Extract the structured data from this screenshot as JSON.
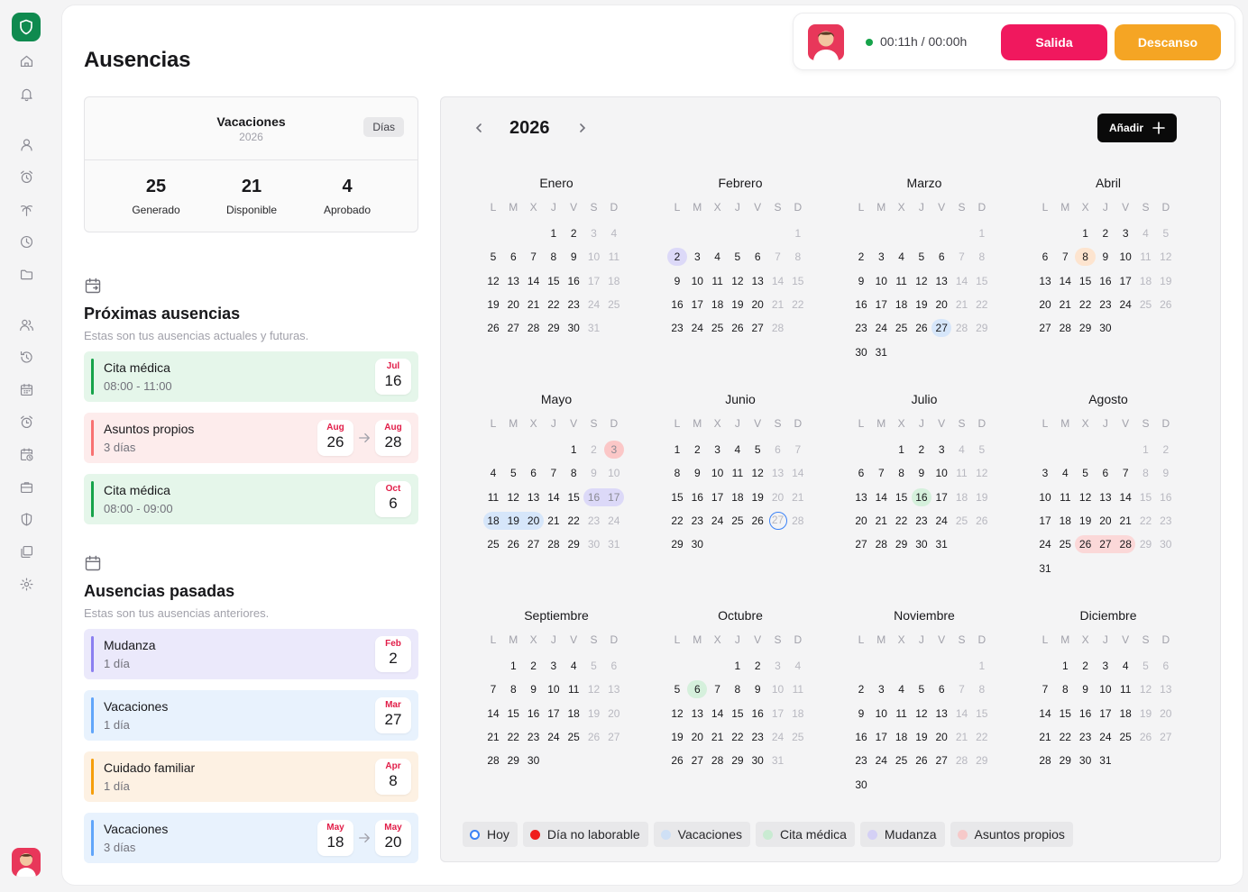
{
  "page": {
    "title": "Ausencias"
  },
  "timer": {
    "time": "00:11h / 00:00h",
    "salida_label": "Salida",
    "descanso_label": "Descanso"
  },
  "colors": {
    "brand": "#0f8a4f",
    "salida": "#f0185e",
    "descanso": "#f5a524",
    "hoy": "#3b82f6",
    "no_laborable": "#ef1d1d",
    "vacaciones": "#dbeafe",
    "cita_medica": "#dcfce7",
    "mudanza": "#e4e1fb",
    "asuntos_propios": "#fee2e2",
    "festivo": "#fecaca"
  },
  "sidebar": {
    "icons": [
      "home-icon",
      "bell-icon",
      "user-icon",
      "alarm-clock-icon",
      "palm-tree-icon",
      "clock-icon",
      "folder-icon",
      "users-icon",
      "history-icon",
      "calendar-icon",
      "alarm-icon",
      "calendar-clock-icon",
      "briefcase-icon",
      "shield-icon",
      "files-icon",
      "settings-icon"
    ]
  },
  "vacaciones": {
    "title": "Vacaciones",
    "year": "2026",
    "badge": "Días",
    "stats": [
      {
        "value": "25",
        "label": "Generado"
      },
      {
        "value": "21",
        "label": "Disponible"
      },
      {
        "value": "4",
        "label": "Aprobado"
      }
    ]
  },
  "proximas": {
    "title": "Próximas ausencias",
    "subtitle": "Estas son tus ausencias actuales y futuras.",
    "items": [
      {
        "name": "Cita médica",
        "sub": "08:00 - 11:00",
        "type": "cita",
        "from": {
          "month": "Jul",
          "day": "16"
        }
      },
      {
        "name": "Asuntos propios",
        "sub": "3 días",
        "type": "asuntos",
        "from": {
          "month": "Aug",
          "day": "26"
        },
        "to": {
          "month": "Aug",
          "day": "28"
        }
      },
      {
        "name": "Cita médica",
        "sub": "08:00 - 09:00",
        "type": "cita",
        "from": {
          "month": "Oct",
          "day": "6"
        }
      }
    ]
  },
  "pasadas": {
    "title": "Ausencias pasadas",
    "subtitle": "Estas son tus ausencias anteriores.",
    "items": [
      {
        "name": "Mudanza",
        "sub": "1 día",
        "type": "mudanza",
        "from": {
          "month": "Feb",
          "day": "2"
        }
      },
      {
        "name": "Vacaciones",
        "sub": "1 día",
        "type": "vacaciones",
        "from": {
          "month": "Mar",
          "day": "27"
        }
      },
      {
        "name": "Cuidado familiar",
        "sub": "1 día",
        "type": "cuidado",
        "from": {
          "month": "Apr",
          "day": "8"
        }
      },
      {
        "name": "Vacaciones",
        "sub": "3 días",
        "type": "vacaciones",
        "from": {
          "month": "May",
          "day": "18"
        },
        "to": {
          "month": "May",
          "day": "20"
        }
      }
    ]
  },
  "calendar": {
    "year": "2026",
    "add_label": "Añadir",
    "weekdays": [
      "L",
      "M",
      "X",
      "J",
      "V",
      "S",
      "D"
    ],
    "months": [
      {
        "name": "Enero",
        "offset": 3,
        "days": 31
      },
      {
        "name": "Febrero",
        "offset": 6,
        "days": 28
      },
      {
        "name": "Marzo",
        "offset": 6,
        "days": 31
      },
      {
        "name": "Abril",
        "offset": 2,
        "days": 30
      },
      {
        "name": "Mayo",
        "offset": 4,
        "days": 31
      },
      {
        "name": "Junio",
        "offset": 0,
        "days": 30
      },
      {
        "name": "Julio",
        "offset": 2,
        "days": 31
      },
      {
        "name": "Agosto",
        "offset": 5,
        "days": 31
      },
      {
        "name": "Septiembre",
        "offset": 1,
        "days": 30
      },
      {
        "name": "Octubre",
        "offset": 3,
        "days": 31
      },
      {
        "name": "Noviembre",
        "offset": 6,
        "days": 30
      },
      {
        "name": "Diciembre",
        "offset": 1,
        "days": 31
      }
    ],
    "marked": [
      {
        "month": 1,
        "day": 2,
        "type": "mudanza"
      },
      {
        "month": 2,
        "day": 27,
        "type": "vacaciones"
      },
      {
        "month": 3,
        "day": 8,
        "type": "cuidado"
      },
      {
        "month": 4,
        "day": 3,
        "type": "festivo"
      },
      {
        "month": 4,
        "day": 16,
        "type": "mudanza"
      },
      {
        "month": 4,
        "day": 17,
        "type": "mudanza"
      },
      {
        "month": 4,
        "day": 18,
        "type": "vacaciones"
      },
      {
        "month": 4,
        "day": 19,
        "type": "vacaciones"
      },
      {
        "month": 4,
        "day": 20,
        "type": "vacaciones"
      },
      {
        "month": 5,
        "day": 27,
        "type": "hoy"
      },
      {
        "month": 6,
        "day": 16,
        "type": "cita"
      },
      {
        "month": 7,
        "day": 26,
        "type": "asuntos"
      },
      {
        "month": 7,
        "day": 27,
        "type": "asuntos"
      },
      {
        "month": 7,
        "day": 28,
        "type": "asuntos"
      },
      {
        "month": 9,
        "day": 6,
        "type": "cita"
      }
    ]
  },
  "legend": [
    {
      "label": "Hoy",
      "type": "hoy"
    },
    {
      "label": "Día no laborable",
      "type": "no_laborable"
    },
    {
      "label": "Vacaciones",
      "type": "vacaciones"
    },
    {
      "label": "Cita médica",
      "type": "cita_medica"
    },
    {
      "label": "Mudanza",
      "type": "mudanza"
    },
    {
      "label": "Asuntos propios",
      "type": "asuntos_propios"
    }
  ]
}
